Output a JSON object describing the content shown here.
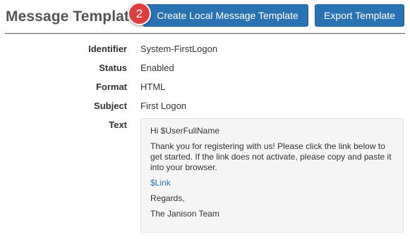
{
  "header": {
    "title": "Message Templat",
    "step_badge": "2",
    "create_button_label": "Create Local Message Template",
    "export_button_label": "Export Template"
  },
  "details": {
    "identifier_label": "Identifier",
    "identifier_value": "System-FirstLogon",
    "status_label": "Status",
    "status_value": "Enabled",
    "format_label": "Format",
    "format_value": "HTML",
    "subject_label": "Subject",
    "subject_value": "First Logon",
    "text_label": "Text"
  },
  "message_text": {
    "greeting": "Hi $UserFullName",
    "body": "Thank you for registering with us!  Please click the link below to get started. If the link does not activate, please copy and paste it into your browser.",
    "link": "$Link",
    "closing": "Regards,",
    "signature": "The Janison Team"
  },
  "colors": {
    "button": "#2a73b3",
    "badge": "#dd3f3f",
    "link": "#2a73b3"
  }
}
